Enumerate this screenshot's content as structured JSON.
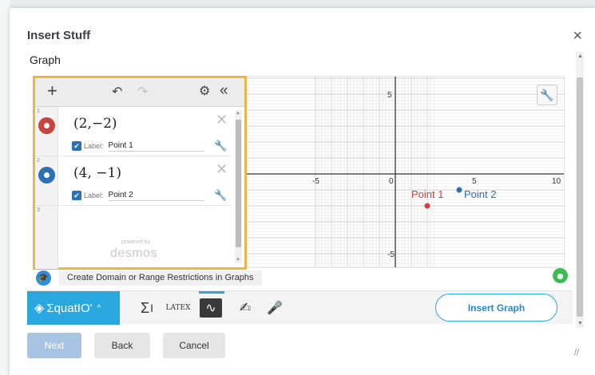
{
  "dialog": {
    "title": "Insert Stuff",
    "close_icon": "×"
  },
  "section": {
    "graph_label": "Graph"
  },
  "graph": {
    "x_ticks": [
      "10",
      "-5",
      "0",
      "5",
      "10"
    ],
    "y_ticks": [
      "5",
      "-5"
    ],
    "points": [
      {
        "label": "Point 1",
        "x": 2,
        "y": -2,
        "color": "#c74440"
      },
      {
        "label": "Point 2",
        "x": 4,
        "y": -1,
        "color": "#2d70b3"
      }
    ]
  },
  "expressions": {
    "items": [
      {
        "index": "1",
        "math": "(2,−2)",
        "label_word": "Label:",
        "label_value": "Point 1",
        "color": "#c74440"
      },
      {
        "index": "2",
        "math": "(4, −1)",
        "label_word": "Label:",
        "label_value": "Point 2",
        "color": "#2d70b3"
      }
    ],
    "empty_index": "3",
    "powered_by": "powered by",
    "brand": "desmos"
  },
  "help": {
    "text": "Create Domain or Range Restrictions in Graphs"
  },
  "equatio": {
    "logo_text": "ƩquatIO'",
    "tools": {
      "sigma": "Σ",
      "latex": "LATEX",
      "graph": "∿",
      "handwriting": "✍",
      "speech": "🎤"
    },
    "insert_label": "Insert Graph",
    "accent": "#29a8e0"
  },
  "footer": {
    "next": "Next",
    "back": "Back",
    "cancel": "Cancel"
  }
}
